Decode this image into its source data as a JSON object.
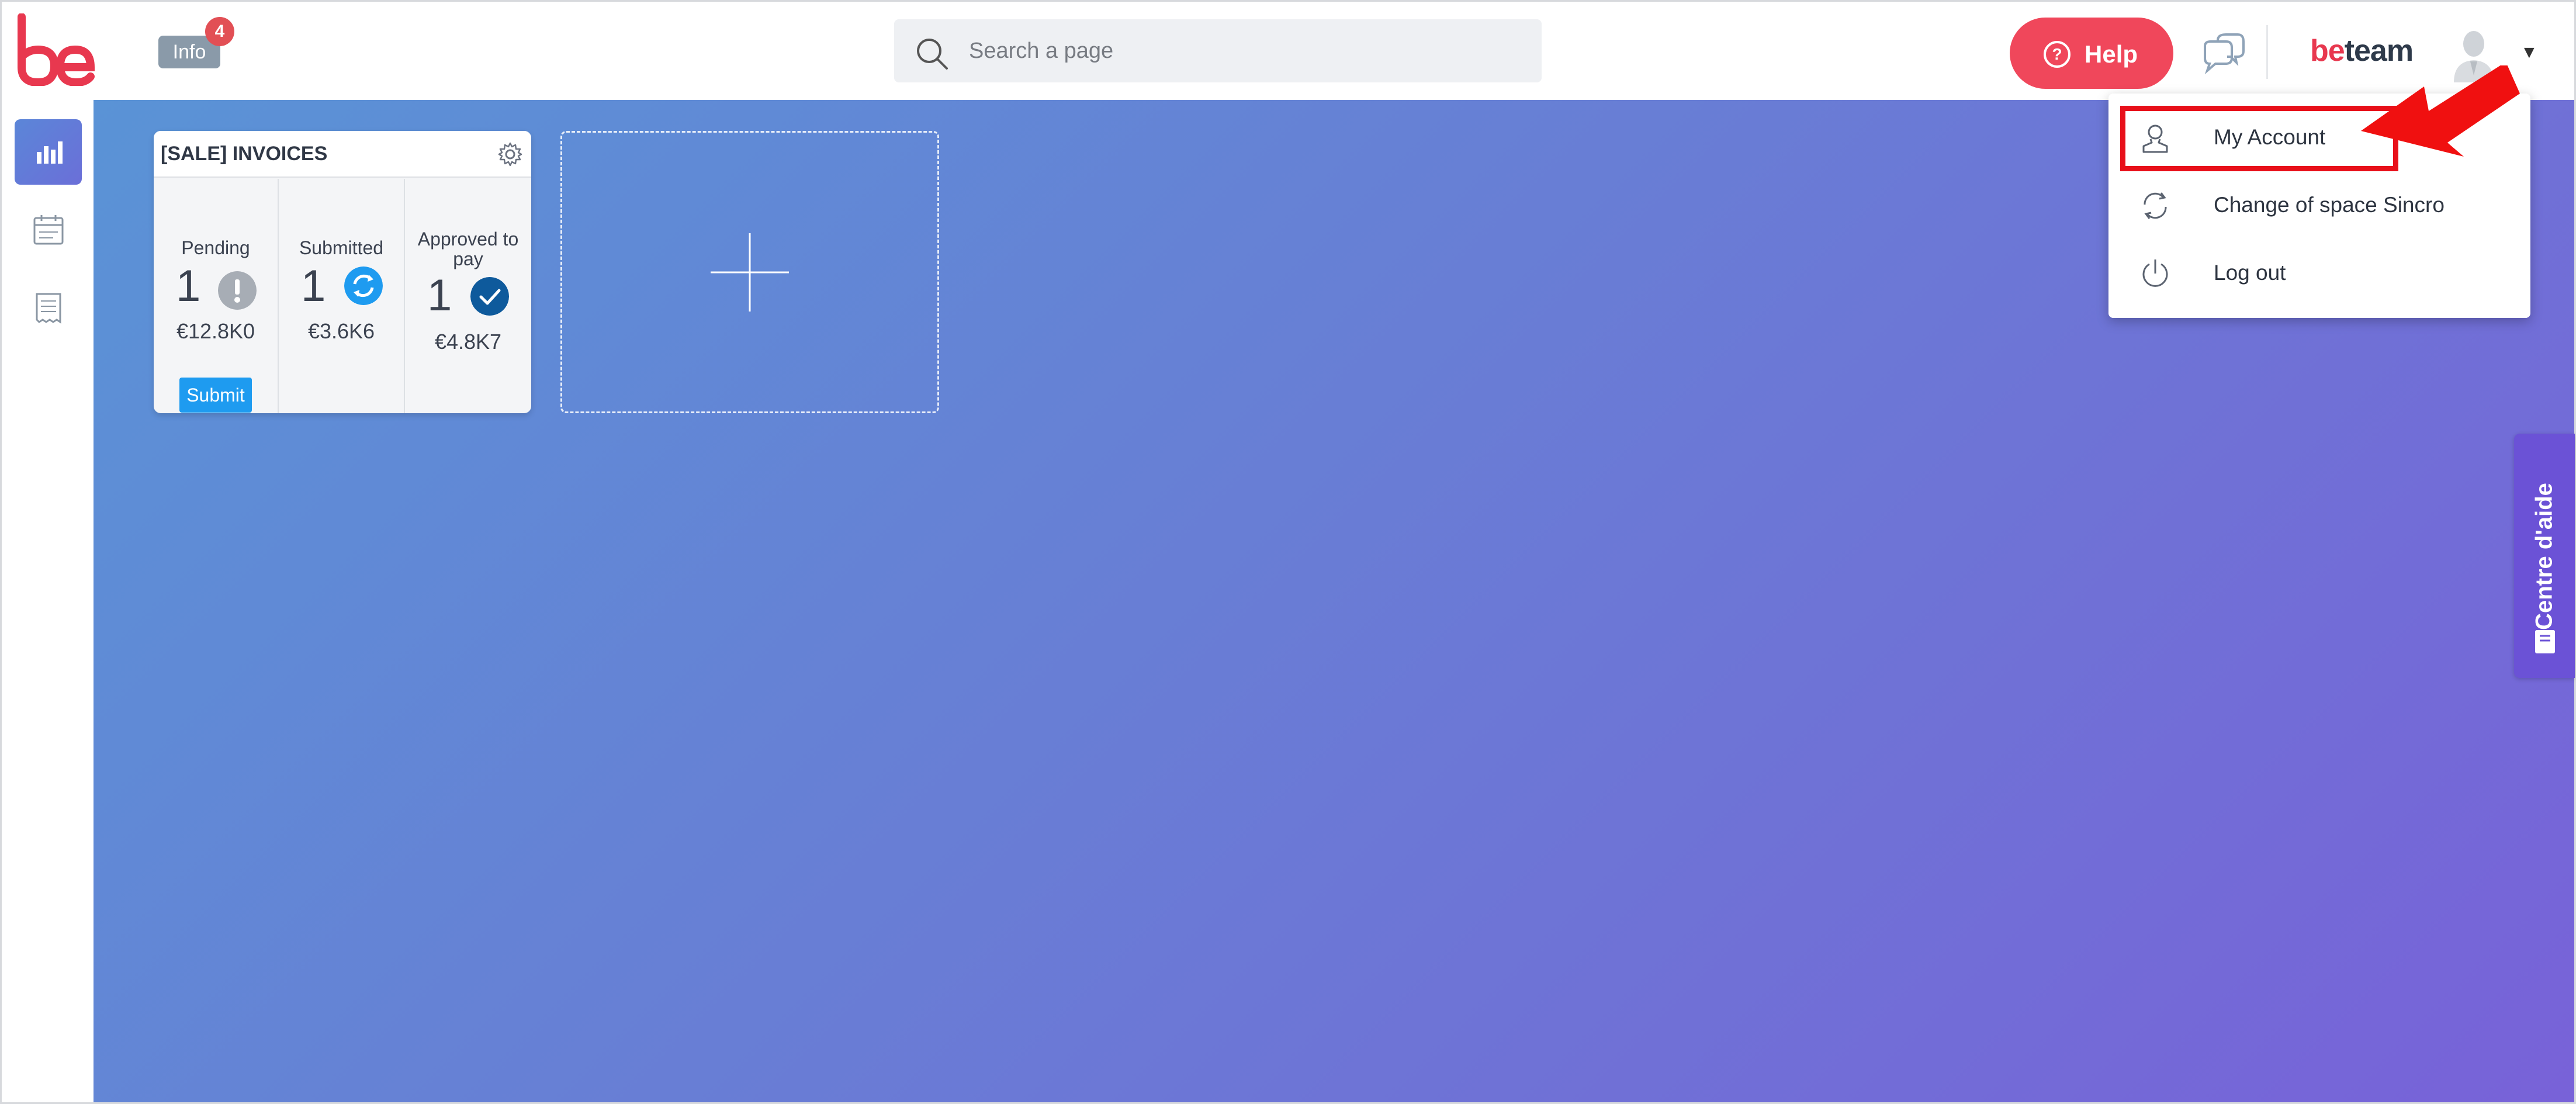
{
  "topbar": {
    "info_label": "Info",
    "info_count": "4",
    "search_placeholder": "Search a page",
    "help_label": "Help",
    "brand_be": "be",
    "brand_team": "team"
  },
  "widget": {
    "title": "[SALE] INVOICES",
    "columns": [
      {
        "label": "Pending",
        "count": "1",
        "amount": "€12.8K0",
        "status_icon": "exclamation-icon",
        "color": "#a7adb5"
      },
      {
        "label": "Submitted",
        "count": "1",
        "amount": "€3.6K6",
        "status_icon": "refresh-icon",
        "color": "#1e9bf0"
      },
      {
        "label": "Approved to pay",
        "count": "1",
        "amount": "€4.8K7",
        "status_icon": "check-icon",
        "color": "#0e5a9c"
      }
    ],
    "submit_label": "Submit"
  },
  "dropdown": {
    "items": [
      {
        "label": "My Account",
        "icon": "user-icon"
      },
      {
        "label": "Change of space Sincro",
        "icon": "refresh-icon"
      },
      {
        "label": "Log out",
        "icon": "power-icon"
      }
    ]
  },
  "aide_tab": {
    "label": "Centre d'aide"
  },
  "colors": {
    "brand_red": "#e8384f",
    "help_button": "#f0475b",
    "accent_blue": "#1e9bf0",
    "highlight": "#e8101a"
  }
}
